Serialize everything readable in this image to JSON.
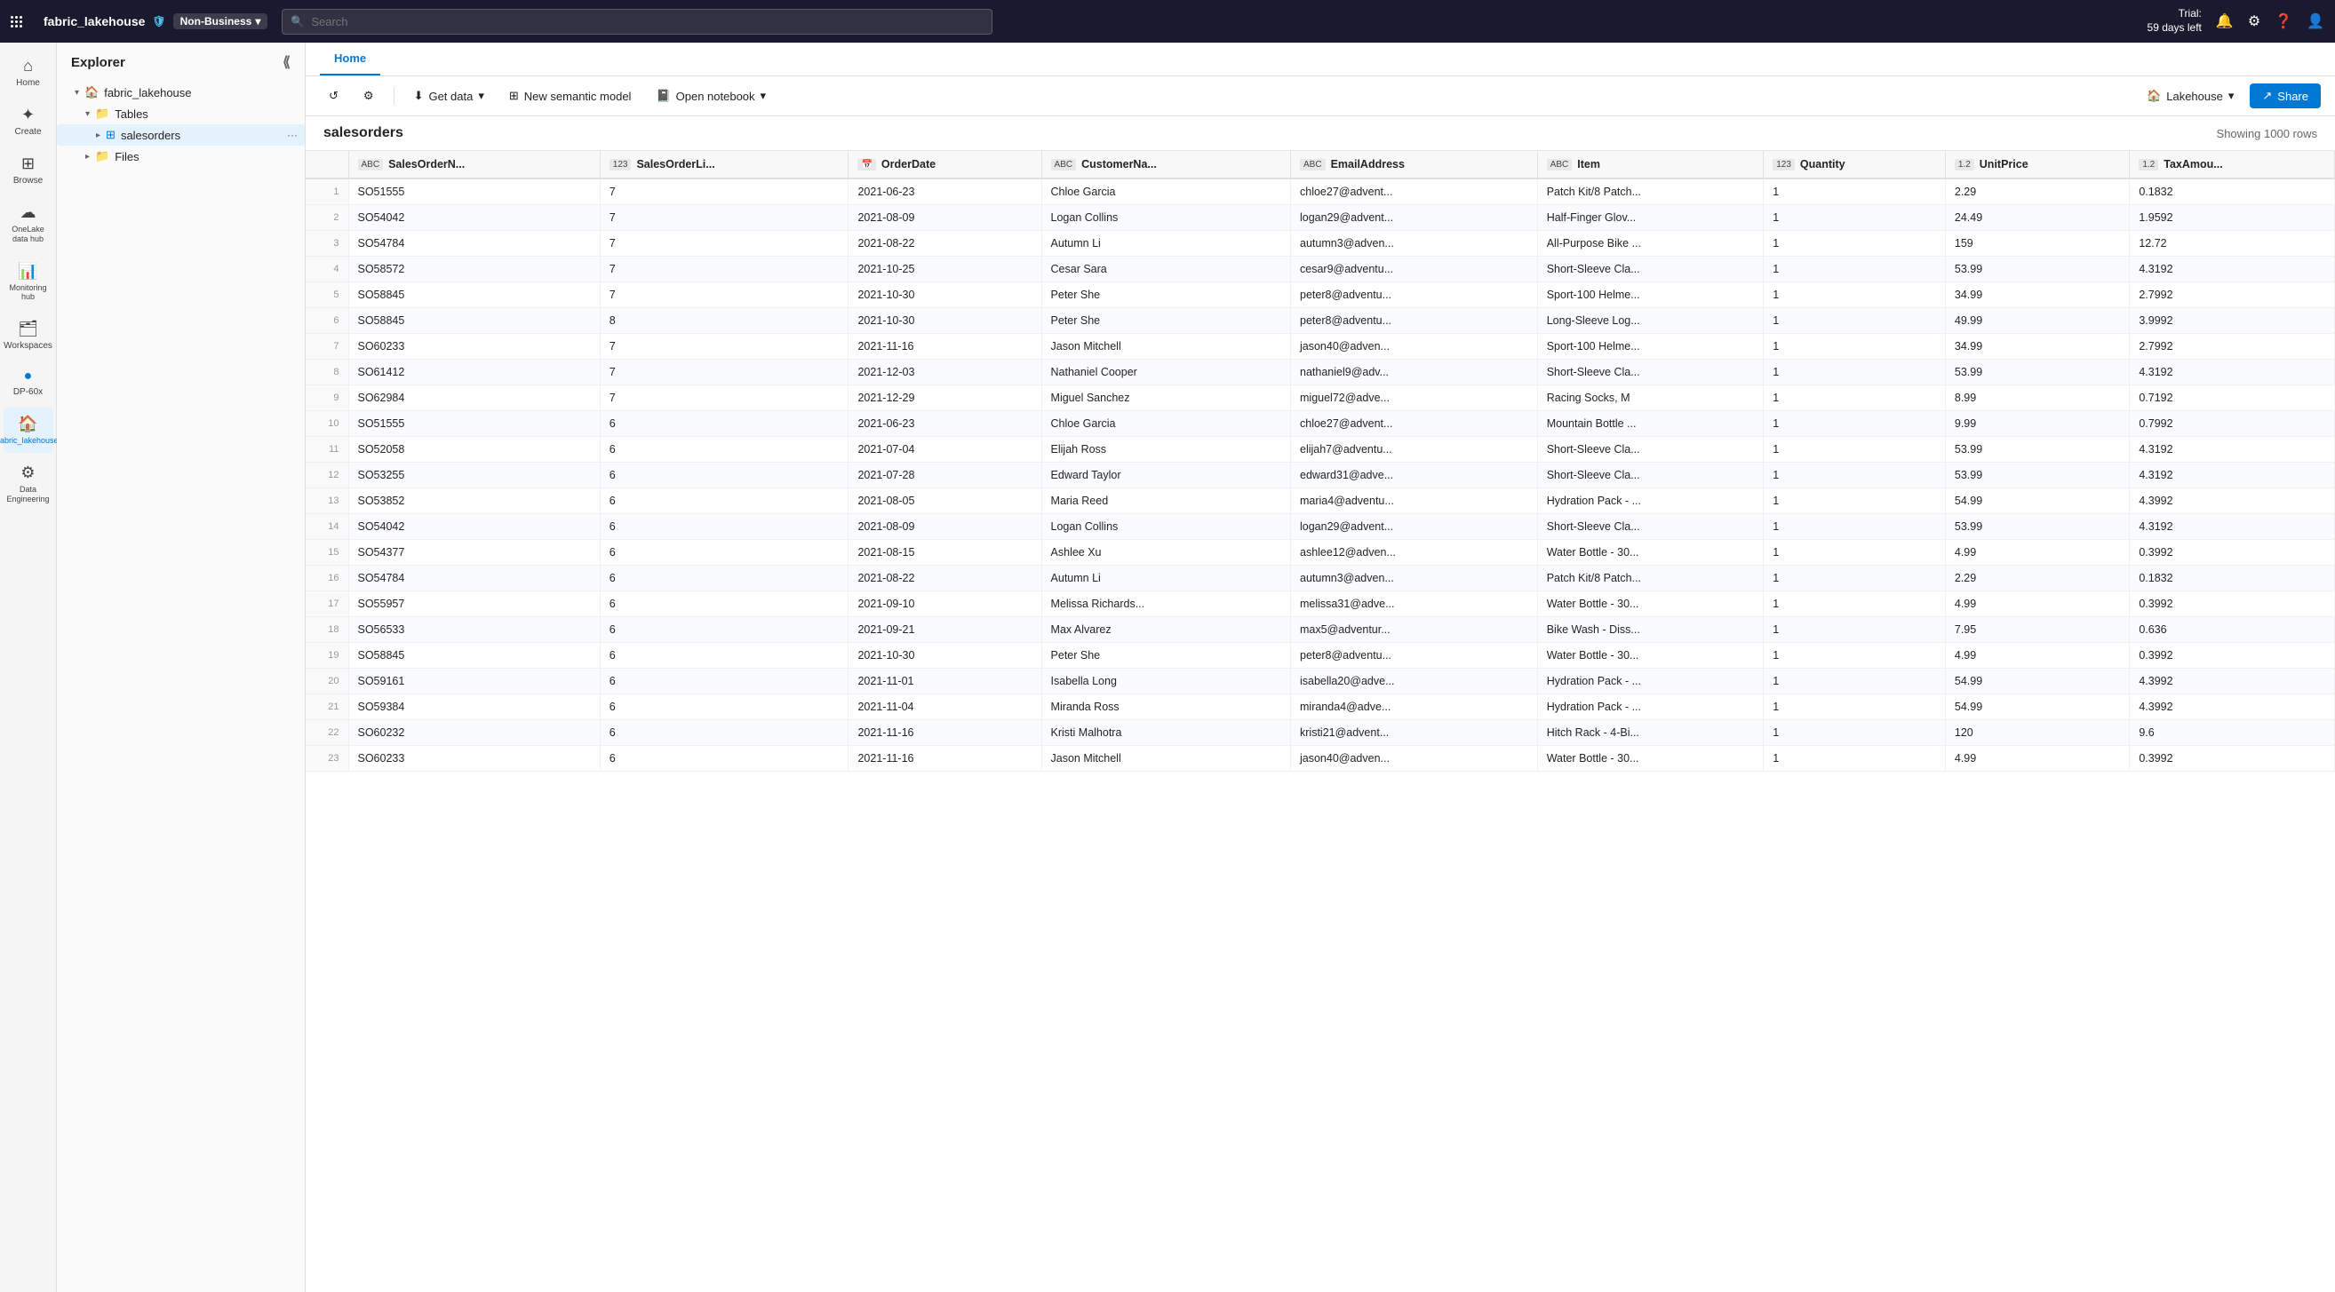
{
  "topbar": {
    "brand": "fabric_lakehouse",
    "sensitivity": "Non-Business",
    "search_placeholder": "Search",
    "trial_label": "Trial:",
    "trial_days": "59 days left"
  },
  "toolbar_right": {
    "lakehouse_label": "Lakehouse",
    "share_label": "Share"
  },
  "tab": {
    "active": "Home"
  },
  "toolbar_actions": {
    "get_data": "Get data",
    "new_semantic_model": "New semantic model",
    "open_notebook": "Open notebook"
  },
  "explorer": {
    "title": "Explorer",
    "root": "fabric_lakehouse",
    "tables_label": "Tables",
    "active_table": "salesorders",
    "files_label": "Files"
  },
  "grid": {
    "title": "salesorders",
    "row_count": "Showing 1000 rows"
  },
  "sidebar_icons": [
    {
      "name": "Home",
      "icon": "⌂"
    },
    {
      "name": "Create",
      "icon": "+"
    },
    {
      "name": "Browse",
      "icon": "⊞"
    },
    {
      "name": "OneLake\ndata hub",
      "icon": "☁"
    },
    {
      "name": "Monitoring\nhub",
      "icon": "📊"
    },
    {
      "name": "Workspaces",
      "icon": "🗂"
    },
    {
      "name": "DP-60x",
      "icon": "🔵"
    },
    {
      "name": "fabric_lakehouse",
      "icon": "🏠",
      "active": true
    },
    {
      "name": "Data\nEngineering",
      "icon": "⚙"
    }
  ],
  "columns": [
    {
      "name": "SalesOrderN...",
      "type": "ABC"
    },
    {
      "name": "SalesOrderLi...",
      "type": "123"
    },
    {
      "name": "OrderDate",
      "type": "📅"
    },
    {
      "name": "CustomerNa...",
      "type": "ABC"
    },
    {
      "name": "EmailAddress",
      "type": "ABC"
    },
    {
      "name": "Item",
      "type": "ABC"
    },
    {
      "name": "Quantity",
      "type": "123"
    },
    {
      "name": "UnitPrice",
      "type": "1.2"
    },
    {
      "name": "TaxAmou...",
      "type": "1.2"
    }
  ],
  "rows": [
    [
      1,
      "SO51555",
      "7",
      "2021-06-23",
      "Chloe Garcia",
      "chloe27@advent...",
      "Patch Kit/8 Patch...",
      "1",
      "2.29",
      "0.1832"
    ],
    [
      2,
      "SO54042",
      "7",
      "2021-08-09",
      "Logan Collins",
      "logan29@advent...",
      "Half-Finger Glov...",
      "1",
      "24.49",
      "1.9592"
    ],
    [
      3,
      "SO54784",
      "7",
      "2021-08-22",
      "Autumn Li",
      "autumn3@adven...",
      "All-Purpose Bike ...",
      "1",
      "159",
      "12.72"
    ],
    [
      4,
      "SO58572",
      "7",
      "2021-10-25",
      "Cesar Sara",
      "cesar9@adventu...",
      "Short-Sleeve Cla...",
      "1",
      "53.99",
      "4.3192"
    ],
    [
      5,
      "SO58845",
      "7",
      "2021-10-30",
      "Peter She",
      "peter8@adventu...",
      "Sport-100 Helme...",
      "1",
      "34.99",
      "2.7992"
    ],
    [
      6,
      "SO58845",
      "8",
      "2021-10-30",
      "Peter She",
      "peter8@adventu...",
      "Long-Sleeve Log...",
      "1",
      "49.99",
      "3.9992"
    ],
    [
      7,
      "SO60233",
      "7",
      "2021-11-16",
      "Jason Mitchell",
      "jason40@adven...",
      "Sport-100 Helme...",
      "1",
      "34.99",
      "2.7992"
    ],
    [
      8,
      "SO61412",
      "7",
      "2021-12-03",
      "Nathaniel Cooper",
      "nathaniel9@adv...",
      "Short-Sleeve Cla...",
      "1",
      "53.99",
      "4.3192"
    ],
    [
      9,
      "SO62984",
      "7",
      "2021-12-29",
      "Miguel Sanchez",
      "miguel72@adve...",
      "Racing Socks, M",
      "1",
      "8.99",
      "0.7192"
    ],
    [
      10,
      "SO51555",
      "6",
      "2021-06-23",
      "Chloe Garcia",
      "chloe27@advent...",
      "Mountain Bottle ...",
      "1",
      "9.99",
      "0.7992"
    ],
    [
      11,
      "SO52058",
      "6",
      "2021-07-04",
      "Elijah Ross",
      "elijah7@adventu...",
      "Short-Sleeve Cla...",
      "1",
      "53.99",
      "4.3192"
    ],
    [
      12,
      "SO53255",
      "6",
      "2021-07-28",
      "Edward Taylor",
      "edward31@adve...",
      "Short-Sleeve Cla...",
      "1",
      "53.99",
      "4.3192"
    ],
    [
      13,
      "SO53852",
      "6",
      "2021-08-05",
      "Maria Reed",
      "maria4@adventu...",
      "Hydration Pack - ...",
      "1",
      "54.99",
      "4.3992"
    ],
    [
      14,
      "SO54042",
      "6",
      "2021-08-09",
      "Logan Collins",
      "logan29@advent...",
      "Short-Sleeve Cla...",
      "1",
      "53.99",
      "4.3192"
    ],
    [
      15,
      "SO54377",
      "6",
      "2021-08-15",
      "Ashlee Xu",
      "ashlee12@adven...",
      "Water Bottle - 30...",
      "1",
      "4.99",
      "0.3992"
    ],
    [
      16,
      "SO54784",
      "6",
      "2021-08-22",
      "Autumn Li",
      "autumn3@adven...",
      "Patch Kit/8 Patch...",
      "1",
      "2.29",
      "0.1832"
    ],
    [
      17,
      "SO55957",
      "6",
      "2021-09-10",
      "Melissa Richards...",
      "melissa31@adve...",
      "Water Bottle - 30...",
      "1",
      "4.99",
      "0.3992"
    ],
    [
      18,
      "SO56533",
      "6",
      "2021-09-21",
      "Max Alvarez",
      "max5@adventur...",
      "Bike Wash - Diss...",
      "1",
      "7.95",
      "0.636"
    ],
    [
      19,
      "SO58845",
      "6",
      "2021-10-30",
      "Peter She",
      "peter8@adventu...",
      "Water Bottle - 30...",
      "1",
      "4.99",
      "0.3992"
    ],
    [
      20,
      "SO59161",
      "6",
      "2021-11-01",
      "Isabella Long",
      "isabella20@adve...",
      "Hydration Pack - ...",
      "1",
      "54.99",
      "4.3992"
    ],
    [
      21,
      "SO59384",
      "6",
      "2021-11-04",
      "Miranda Ross",
      "miranda4@adve...",
      "Hydration Pack - ...",
      "1",
      "54.99",
      "4.3992"
    ],
    [
      22,
      "SO60232",
      "6",
      "2021-11-16",
      "Kristi Malhotra",
      "kristi21@advent...",
      "Hitch Rack - 4-Bi...",
      "1",
      "120",
      "9.6"
    ],
    [
      23,
      "SO60233",
      "6",
      "2021-11-16",
      "Jason Mitchell",
      "jason40@adven...",
      "Water Bottle - 30...",
      "1",
      "4.99",
      "0.3992"
    ]
  ]
}
